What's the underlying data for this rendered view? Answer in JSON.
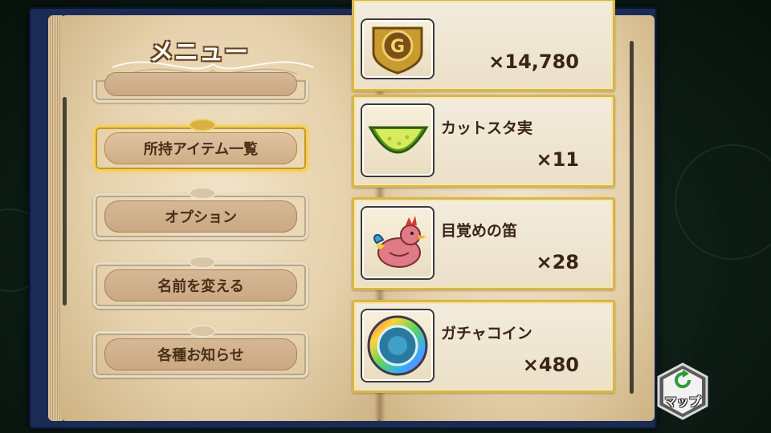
{
  "menu": {
    "title": "メニュー",
    "partial_label": "",
    "items": [
      {
        "label": "所持アイテム一覧",
        "selected": true
      },
      {
        "label": "オプション",
        "selected": false
      },
      {
        "label": "名前を変える",
        "selected": false
      },
      {
        "label": "各種お知らせ",
        "selected": false
      }
    ]
  },
  "inventory": {
    "items": [
      {
        "name": "",
        "count": "×14,780",
        "icon": "gold-coin-icon"
      },
      {
        "name": "カットスタ実",
        "count": "×11",
        "icon": "melon-slice-icon"
      },
      {
        "name": "目覚めの笛",
        "count": "×28",
        "icon": "rooster-whistle-icon"
      },
      {
        "name": "ガチャコイン",
        "count": "×480",
        "icon": "rainbow-coin-icon"
      }
    ]
  },
  "map_button": {
    "label": "マップ",
    "icon": "refresh-arrow-icon"
  },
  "colors": {
    "gold_frame": "#d9b54a",
    "book_cover": "#1a2c55",
    "text_brown": "#3a2414"
  }
}
